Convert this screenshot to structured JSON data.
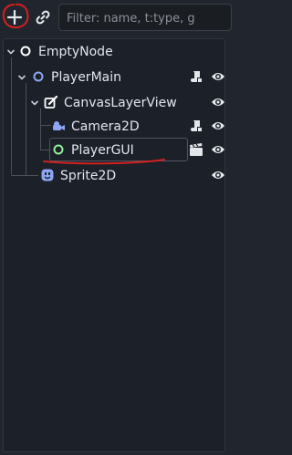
{
  "toolbar": {
    "add_icon": "plus-icon",
    "link_icon": "link-icon",
    "filter_placeholder": "Filter: name, t:type, g"
  },
  "tree": {
    "nodes": [
      {
        "label": "EmptyNode",
        "icon": "node-ring-icon",
        "icon_color": "#ffffff"
      },
      {
        "label": "PlayerMain",
        "icon": "node2d-ring-icon",
        "icon_color": "#8da5f3",
        "has_script": true,
        "visible": true
      },
      {
        "label": "CanvasLayerView",
        "icon": "canvas-layer-icon",
        "icon_color": "#ffffff",
        "visible": true
      },
      {
        "label": "Camera2D",
        "icon": "camera2d-icon",
        "icon_color": "#8da5f3",
        "has_script": true,
        "visible": true
      },
      {
        "label": "PlayerGUI",
        "icon": "control-ring-icon",
        "icon_color": "#8eef97",
        "has_scene": true,
        "visible": true
      },
      {
        "label": "Sprite2D",
        "icon": "sprite2d-icon",
        "icon_color": "#8da5f3",
        "visible": true
      }
    ]
  },
  "colors": {
    "background": "#21262e",
    "panel": "#1c2028",
    "annotation": "#d22020"
  }
}
